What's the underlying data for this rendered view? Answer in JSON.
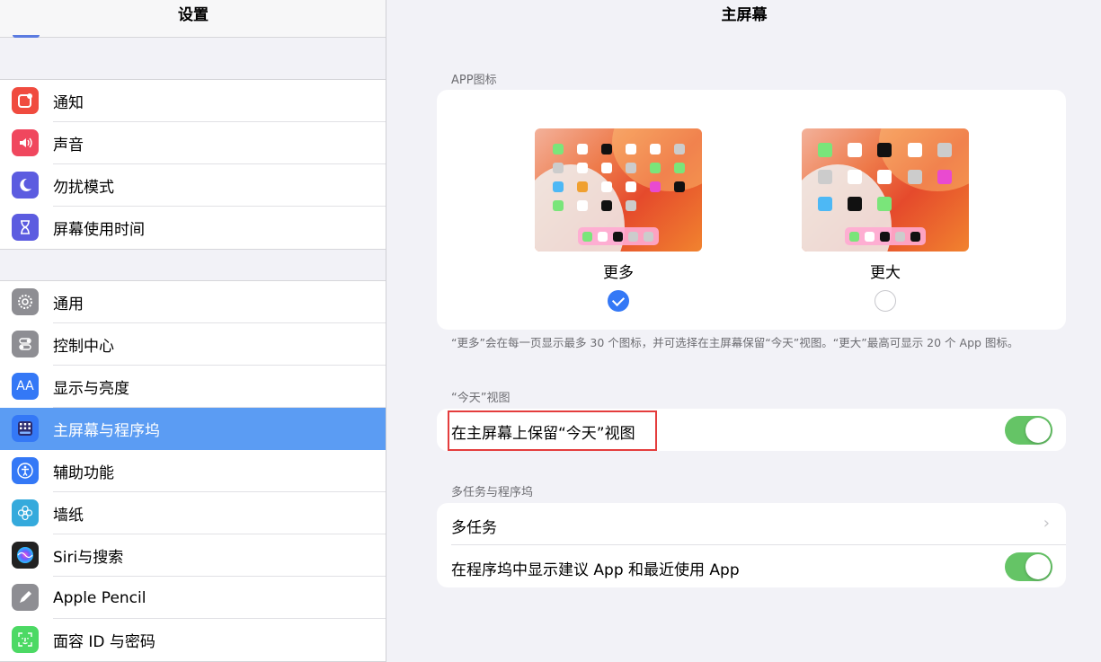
{
  "left_pane": {
    "title": "设置",
    "group1": [
      {
        "label": "通知",
        "icon": "notifications-icon",
        "color": "#f04b3f"
      },
      {
        "label": "声音",
        "icon": "sound-icon",
        "color": "#f0475e"
      },
      {
        "label": "勿扰模式",
        "icon": "moon-icon",
        "color": "#5c5ce0"
      },
      {
        "label": "屏幕使用时间",
        "icon": "hourglass-icon",
        "color": "#5c5ce0"
      }
    ],
    "group2": [
      {
        "label": "通用",
        "icon": "gear-icon",
        "color": "#8e8e93"
      },
      {
        "label": "控制中心",
        "icon": "toggles-icon",
        "color": "#8e8e93"
      },
      {
        "label": "显示与亮度",
        "icon": "text-size-icon",
        "color": "#3478f6"
      },
      {
        "label": "主屏幕与程序坞",
        "icon": "home-screen-icon",
        "color": "#3478f6",
        "selected": true
      },
      {
        "label": "辅助功能",
        "icon": "accessibility-icon",
        "color": "#3478f6"
      },
      {
        "label": "墙纸",
        "icon": "flower-icon",
        "color": "#35aadc"
      },
      {
        "label": "Siri与搜索",
        "icon": "siri-icon",
        "color": "#222222"
      },
      {
        "label": "Apple Pencil",
        "icon": "pencil-icon",
        "color": "#8e8e93"
      },
      {
        "label": "面容 ID 与密码",
        "icon": "face-id-icon",
        "color": "#4cd964"
      }
    ]
  },
  "right_pane": {
    "title": "主屏幕",
    "app_icons_section": {
      "label": "APP图标",
      "option_more": "更多",
      "option_bigger": "更大",
      "selected": "更多",
      "note": "“更多”会在每一页显示最多 30 个图标，并可选择在主屏幕保留“今天”视图。“更大”最高可显示 20 个 App 图标。"
    },
    "today_section": {
      "label": "“今天”视图",
      "row_label": "在主屏幕上保留“今天”视图",
      "toggle_on": true
    },
    "multitask_section": {
      "label": "多任务与程序坞",
      "row1_label": "多任务",
      "row2_label": "在程序坞中显示建议 App 和最近使用 App",
      "row2_toggle_on": true
    }
  },
  "colors": {
    "selected_row": "#5b9cf3",
    "toggle_on": "#65c466",
    "radio_checked": "#3478f6",
    "highlight": "#e43d3d"
  }
}
